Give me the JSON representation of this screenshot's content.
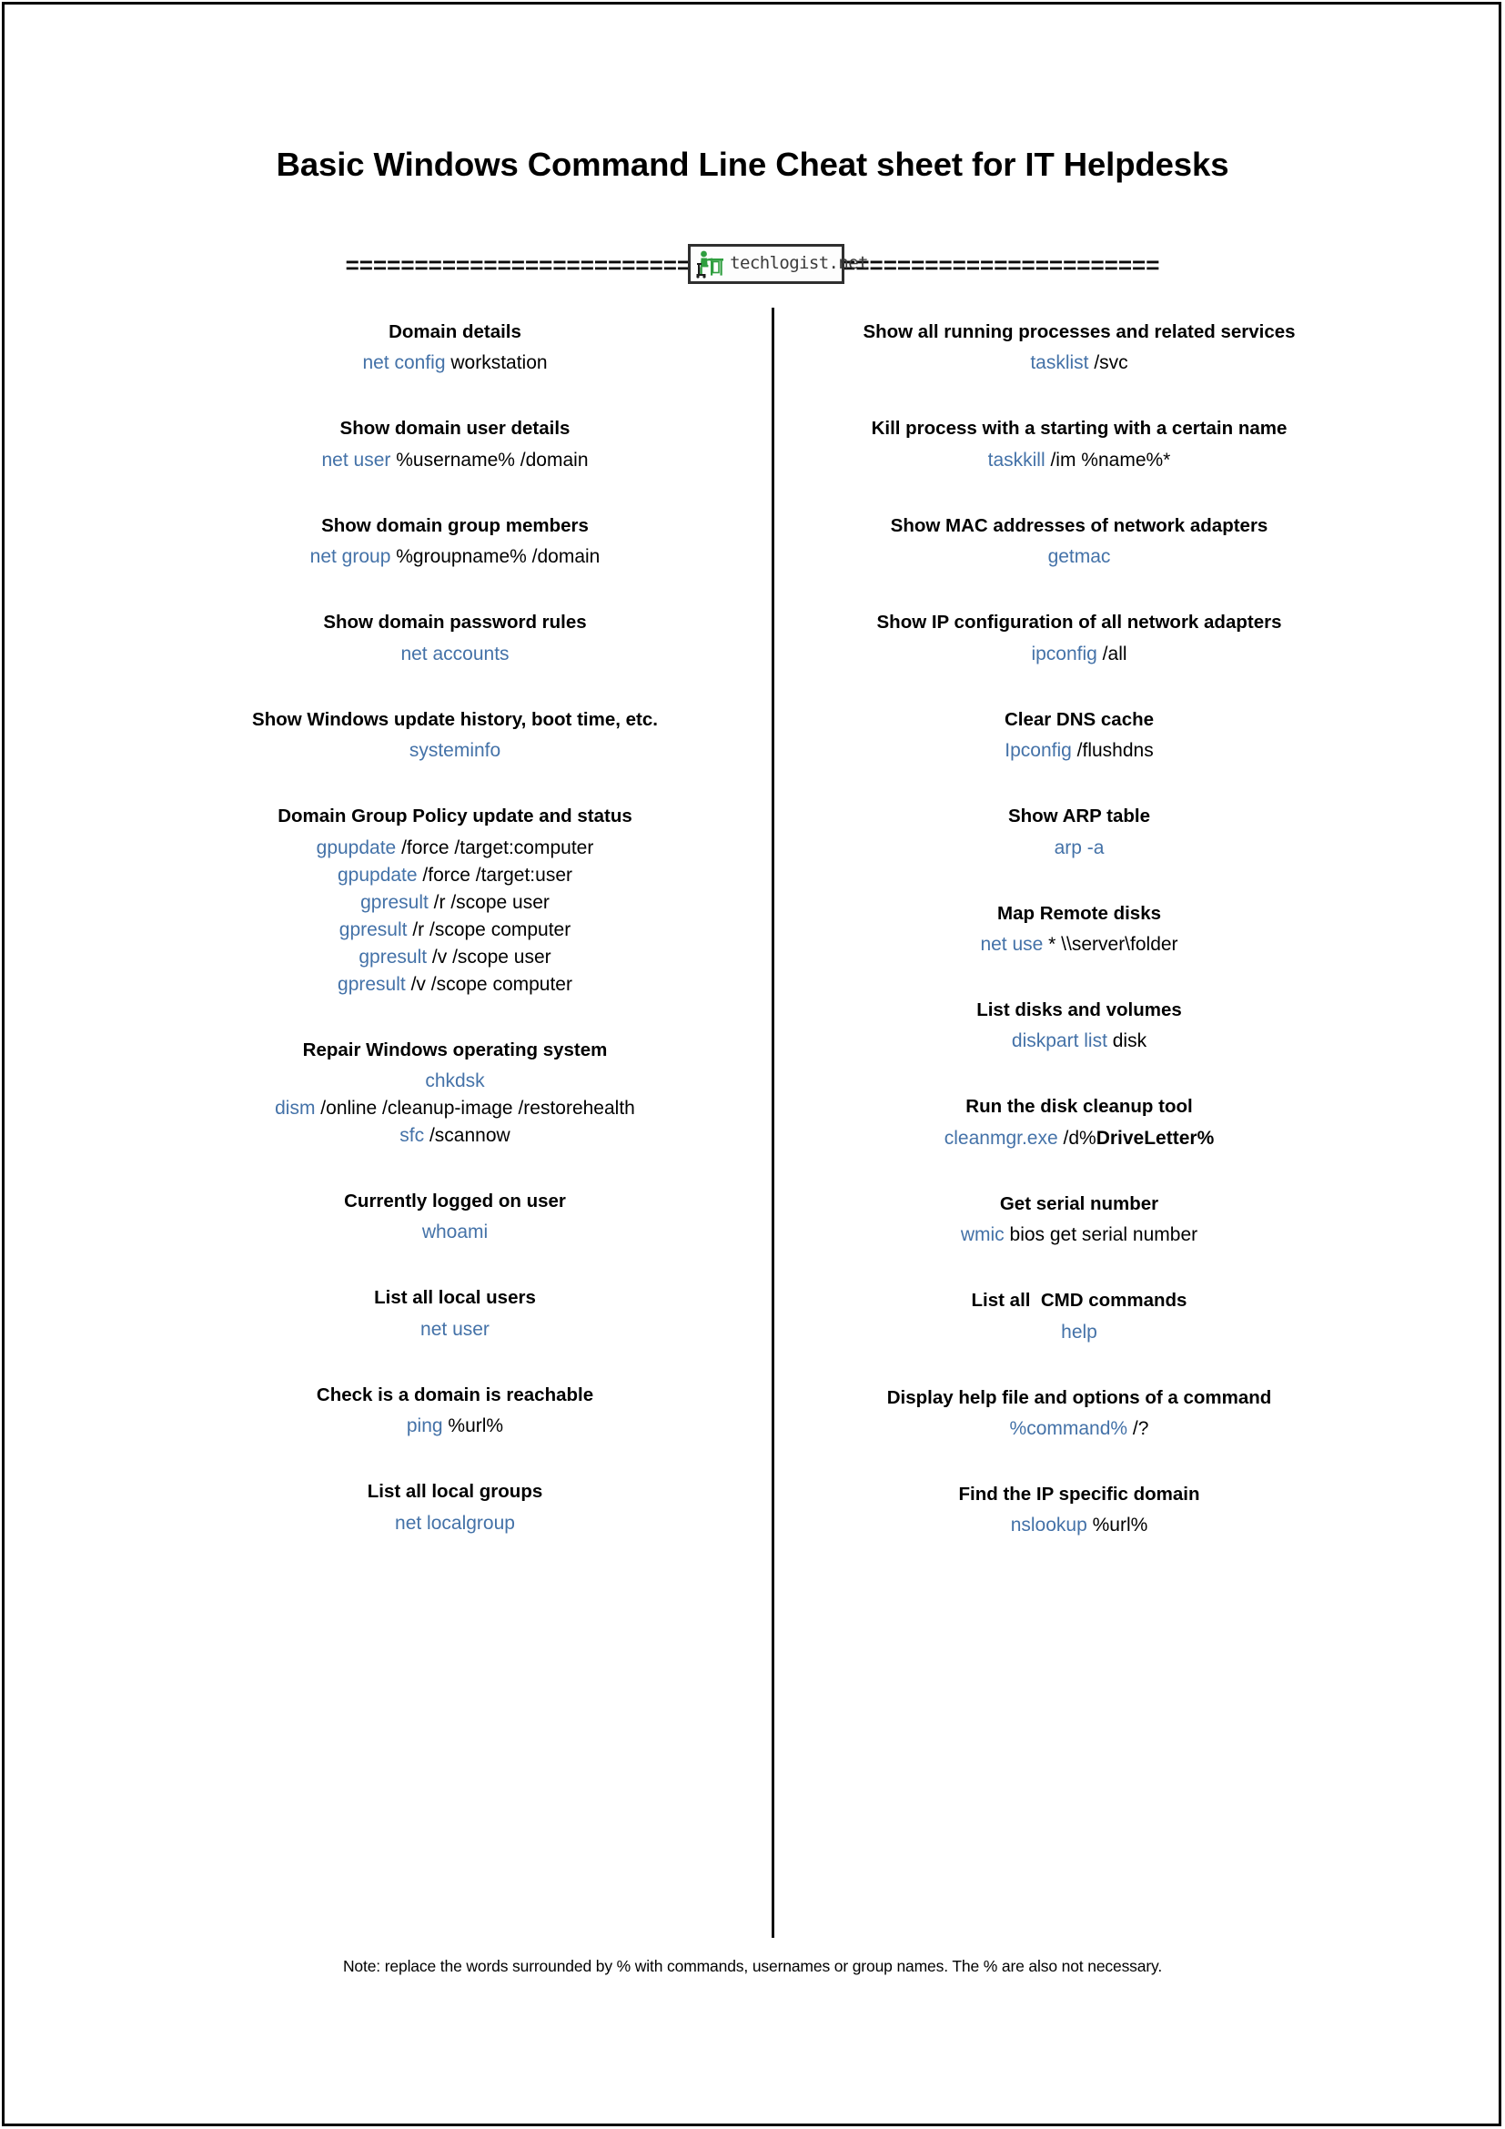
{
  "page": {
    "title": "Basic Windows Command Line Cheat sheet for IT Helpdesks",
    "separator_left": "=========================",
    "separator_right": "=======================",
    "note": "Note: replace the words surrounded by % with commands, usernames or group names. The % are also not necessary."
  },
  "logo": {
    "text": "techlogist.net",
    "mark": "person-at-desk-icon",
    "mark_color": "#2f9e3f",
    "border_color": "#2f2f2f"
  },
  "colors": {
    "command_blue": "#4472a8",
    "text_black": "#000000",
    "divider": "#111111",
    "page_background": "#ffffff"
  },
  "left_column": [
    {
      "title": "Domain details",
      "commands": [
        {
          "cmd": "net config",
          "arg": " workstation"
        }
      ]
    },
    {
      "title": "Show domain user details",
      "commands": [
        {
          "cmd": "net user",
          "arg": " %username% /domain"
        }
      ]
    },
    {
      "title": "Show domain group members",
      "commands": [
        {
          "cmd": "net group",
          "arg": " %groupname% /domain"
        }
      ]
    },
    {
      "title": "Show domain password rules",
      "commands": [
        {
          "cmd": "net accounts",
          "arg": ""
        }
      ]
    },
    {
      "title": "Show Windows update history, boot time, etc.",
      "commands": [
        {
          "cmd": "systeminfo",
          "arg": ""
        }
      ]
    },
    {
      "title": "Domain Group Policy update and status",
      "commands": [
        {
          "cmd": "gpupdate",
          "arg": " /force /target:computer"
        },
        {
          "cmd": "gpupdate",
          "arg": " /force /target:user"
        },
        {
          "cmd": "gpresult",
          "arg": " /r /scope user"
        },
        {
          "cmd": "gpresult",
          "arg": " /r /scope computer"
        },
        {
          "cmd": "gpresult",
          "arg": " /v /scope user"
        },
        {
          "cmd": "gpresult",
          "arg": " /v /scope computer"
        }
      ]
    },
    {
      "title": "Repair Windows operating system",
      "commands": [
        {
          "cmd": "chkdsk",
          "arg": ""
        },
        {
          "cmd": "dism",
          "arg": " /online /cleanup-image /restorehealth"
        },
        {
          "cmd": "sfc",
          "arg": " /scannow"
        }
      ]
    },
    {
      "title": "Currently logged on user",
      "commands": [
        {
          "cmd": "whoami",
          "arg": ""
        }
      ]
    },
    {
      "title": "List all local users",
      "commands": [
        {
          "cmd": "net user",
          "arg": ""
        }
      ]
    },
    {
      "title": "Check is a domain is reachable",
      "commands": [
        {
          "cmd": "ping",
          "arg": " %url%"
        }
      ]
    },
    {
      "title": "List all local groups",
      "commands": [
        {
          "cmd": "net localgroup",
          "arg": ""
        }
      ]
    }
  ],
  "right_column": [
    {
      "title": "Show all running processes and related services",
      "commands": [
        {
          "cmd": "tasklist",
          "arg": " /svc"
        }
      ]
    },
    {
      "title": "Kill process with a starting with a certain name",
      "commands": [
        {
          "cmd": "taskkill",
          "arg": " /im %name%*"
        }
      ]
    },
    {
      "title": "Show MAC addresses of network adapters",
      "commands": [
        {
          "cmd": "getmac",
          "arg": ""
        }
      ]
    },
    {
      "title": "Show IP configuration of all network adapters",
      "commands": [
        {
          "cmd": "ipconfig",
          "arg": " /all"
        }
      ]
    },
    {
      "title": "Clear DNS cache",
      "commands": [
        {
          "cmd": "Ipconfig",
          "arg": " /flushdns"
        }
      ]
    },
    {
      "title": "Show ARP table",
      "commands": [
        {
          "cmd": "arp -a",
          "arg": ""
        }
      ]
    },
    {
      "title": "Map Remote disks",
      "commands": [
        {
          "cmd": "net use",
          "arg": " * \\\\server\\folder"
        }
      ]
    },
    {
      "title": "List disks and volumes",
      "commands": [
        {
          "cmd": "diskpart list",
          "arg": " disk"
        }
      ]
    },
    {
      "title": "Run the disk cleanup tool",
      "commands": [
        {
          "cmd": "cleanmgr.exe",
          "arg": " /d%",
          "arg_bold": "DriveLetter%"
        }
      ]
    },
    {
      "title": "Get serial number",
      "commands": [
        {
          "cmd": "wmic",
          "arg": " bios get serial number"
        }
      ]
    },
    {
      "title": "List all  CMD commands",
      "commands": [
        {
          "cmd": "help",
          "arg": ""
        }
      ]
    },
    {
      "title": "Display help file and options of a command",
      "commands": [
        {
          "cmd": "%command%",
          "arg": " /?"
        }
      ]
    },
    {
      "title": "Find the IP specific domain",
      "commands": [
        {
          "cmd": "nslookup",
          "arg": " %url%"
        }
      ]
    }
  ]
}
